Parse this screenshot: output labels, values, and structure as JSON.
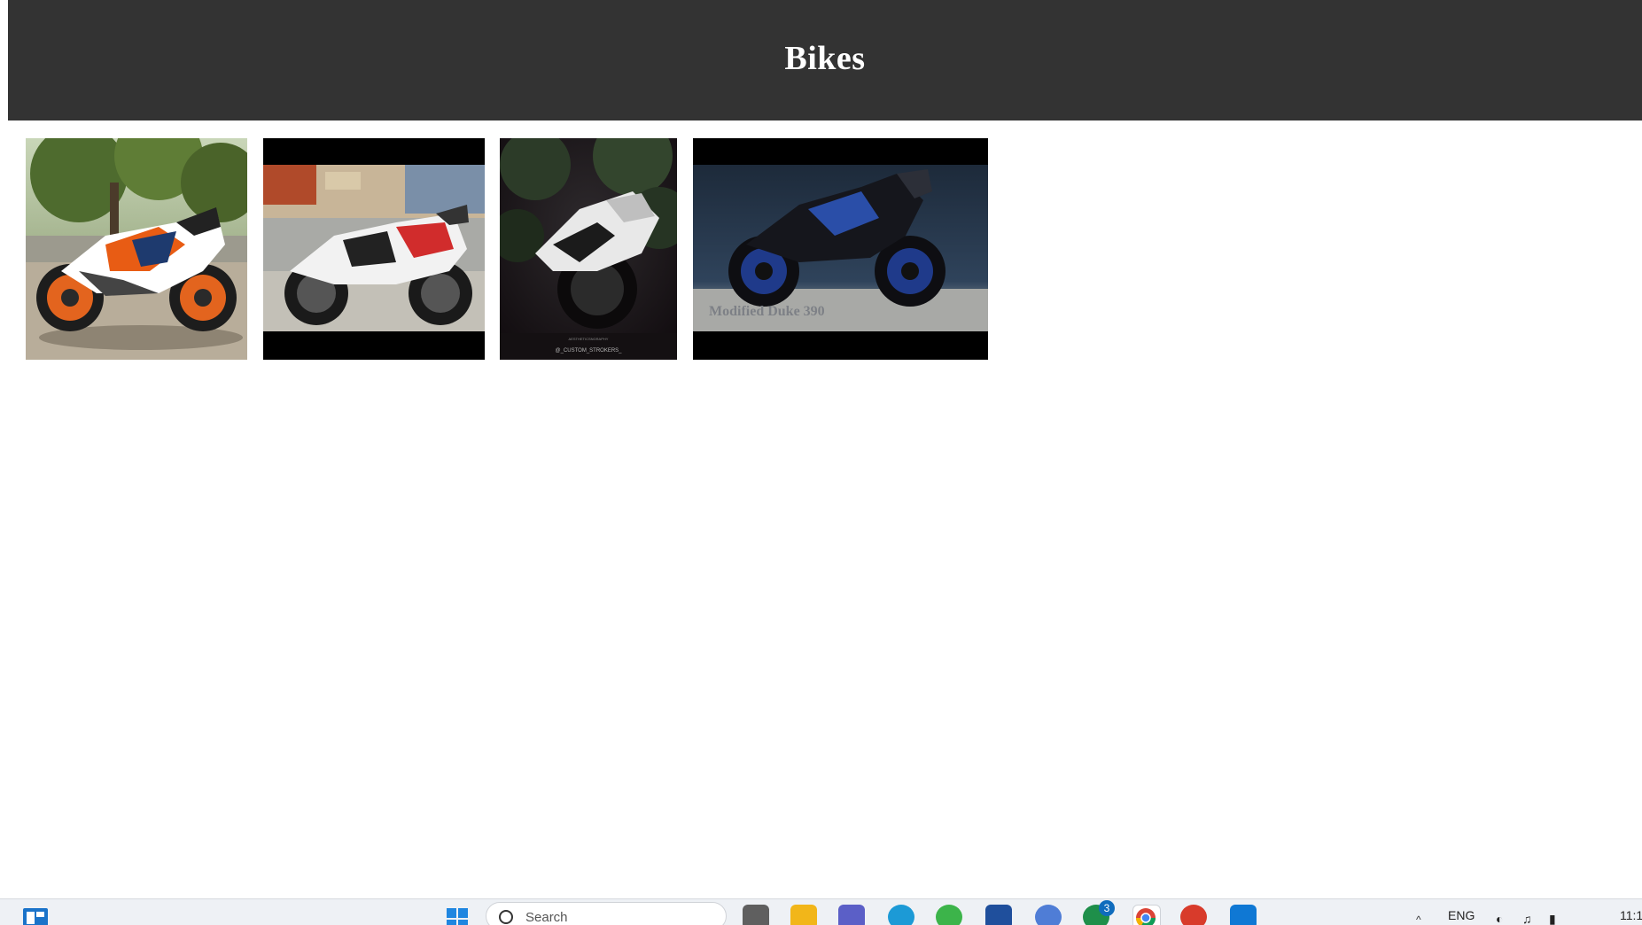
{
  "page": {
    "title": "Bikes"
  },
  "gallery": {
    "photos": [
      {
        "name": "bike-photo-1",
        "alt": "Orange KTM RC sport bike parked under trees"
      },
      {
        "name": "bike-photo-2",
        "alt": "White and black sport bike on street"
      },
      {
        "name": "bike-photo-3",
        "alt": "White sport bike against dark foliage",
        "caption": "@_CUSTOM_STROKERS_"
      },
      {
        "name": "bike-photo-4",
        "alt": "Blue and black naked street bike",
        "caption": "Modified Duke 390"
      }
    ]
  },
  "taskbar": {
    "search_placeholder": "Search",
    "language": "ENG",
    "clock": "11:1",
    "notification_count": "3",
    "icons": [
      "widgets-icon",
      "start-icon",
      "search-icon",
      "file-explorer-icon",
      "folder-icon",
      "teams-icon",
      "edge-icon",
      "refresh-app-icon",
      "store-icon",
      "app-icon",
      "whatsapp-icon",
      "chrome-icon",
      "office-icon",
      "vscode-icon"
    ]
  },
  "colors": {
    "header_bg": "#333333",
    "header_text": "#ffffff",
    "page_bg": "#ffffff"
  }
}
